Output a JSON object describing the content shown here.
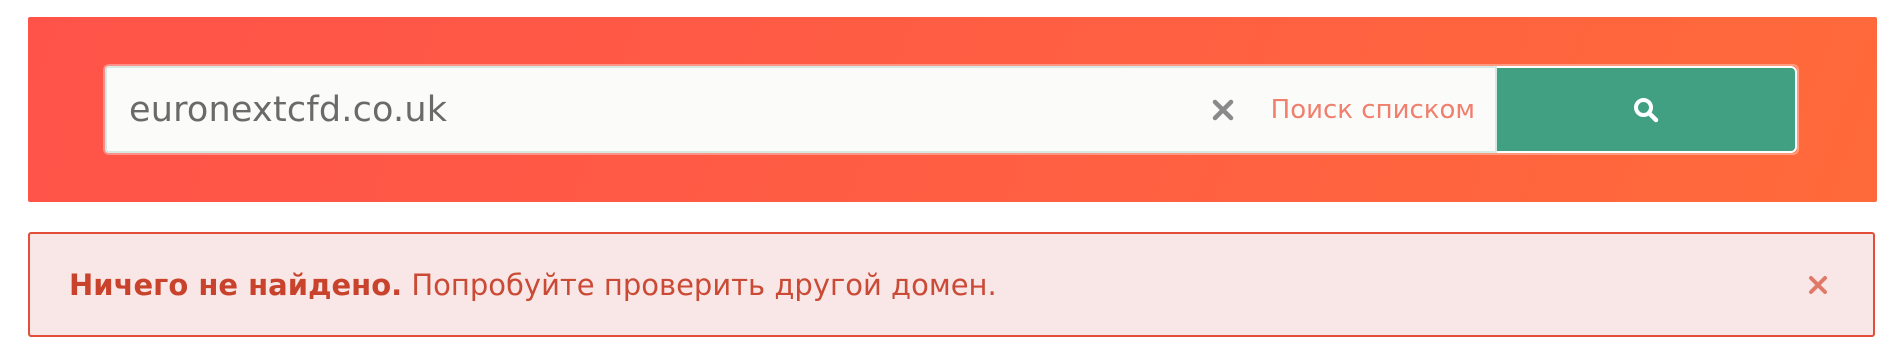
{
  "search": {
    "value": "euronextcfd.co.uk",
    "list_search_label": "Поиск списком",
    "clear_icon": "close-icon",
    "submit_icon": "search-icon"
  },
  "alert": {
    "strong_text": "Ничего не найдено.",
    "message": " Попробуйте проверить другой домен.",
    "close_icon": "close-icon"
  },
  "colors": {
    "banner_start": "#ff5349",
    "banner_end": "#ff6a3a",
    "search_button": "#41a081",
    "alert_background": "#f8e7e6",
    "alert_border": "#e24e3a",
    "alert_text": "#cb4a35",
    "link": "#f07f6e"
  }
}
